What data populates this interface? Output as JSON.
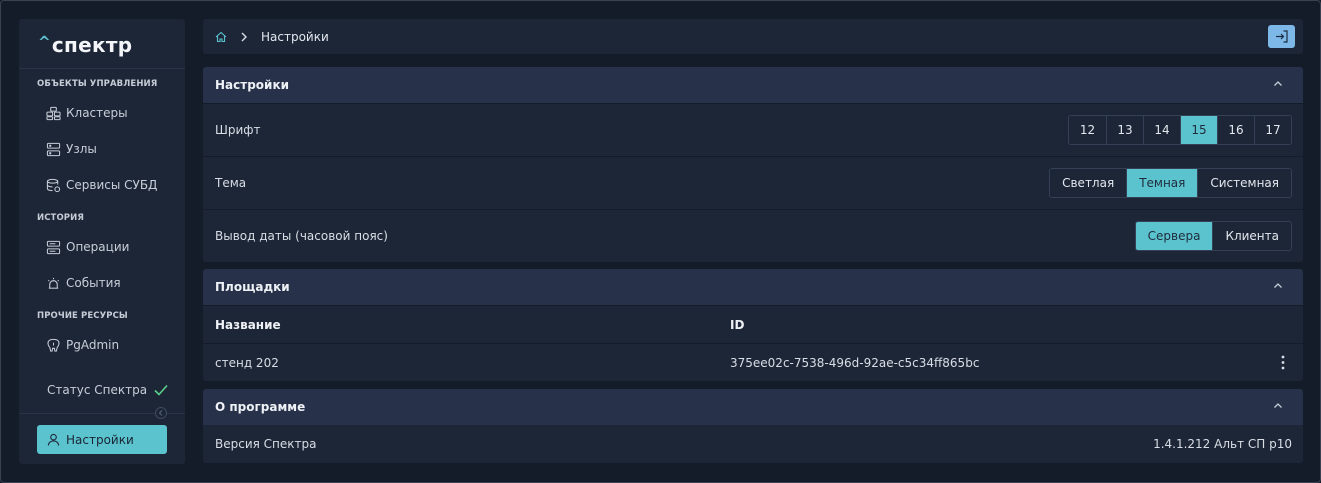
{
  "app": {
    "logo_caret": "^",
    "logo_text": "спектр"
  },
  "sidebar": {
    "sections": [
      {
        "title": "ОБЪЕКТЫ УПРАВЛЕНИЯ",
        "items": [
          {
            "label": "Кластеры",
            "icon": "clusters-icon"
          },
          {
            "label": "Узлы",
            "icon": "server-icon"
          },
          {
            "label": "Сервисы СУБД",
            "icon": "database-service-icon"
          }
        ]
      },
      {
        "title": "ИСТОРИЯ",
        "items": [
          {
            "label": "Операции",
            "icon": "operations-icon"
          },
          {
            "label": "События",
            "icon": "alarm-icon"
          }
        ]
      },
      {
        "title": "ПРОЧИЕ РЕСУРСЫ",
        "items": [
          {
            "label": "PgAdmin",
            "icon": "postgres-elephant-icon"
          }
        ]
      }
    ],
    "status_label": "Статус Спектра",
    "status_icon": "checkmark-icon",
    "settings_button": "Настройки"
  },
  "topbar": {
    "home_icon": "home-icon",
    "breadcrumb": "Настройки",
    "logout_icon": "logout-icon"
  },
  "settings_panel": {
    "title": "Настройки",
    "font": {
      "label": "Шрифт",
      "options": [
        "12",
        "13",
        "14",
        "15",
        "16",
        "17"
      ],
      "selected": "15"
    },
    "theme": {
      "label": "Тема",
      "options": [
        "Светлая",
        "Темная",
        "Системная"
      ],
      "selected": "Темная"
    },
    "date_output": {
      "label": "Вывод даты (часовой пояс)",
      "options": [
        "Сервера",
        "Клиента"
      ],
      "selected": "Сервера"
    }
  },
  "sites_panel": {
    "title": "Площадки",
    "columns": [
      "Название",
      "ID"
    ],
    "rows": [
      {
        "name": "стенд 202",
        "id": "375ee02c-7538-496d-92ae-c5c34ff865bc"
      }
    ]
  },
  "about_panel": {
    "title": "О программе",
    "version_label": "Версия Спектра",
    "version_value": "1.4.1.212 Альт СП р10"
  },
  "colors": {
    "accent": "#5bc3ce",
    "logout_button": "#7db8e8",
    "background": "#141c2a",
    "panel": "#1d2637",
    "panel_header": "#27324a"
  }
}
